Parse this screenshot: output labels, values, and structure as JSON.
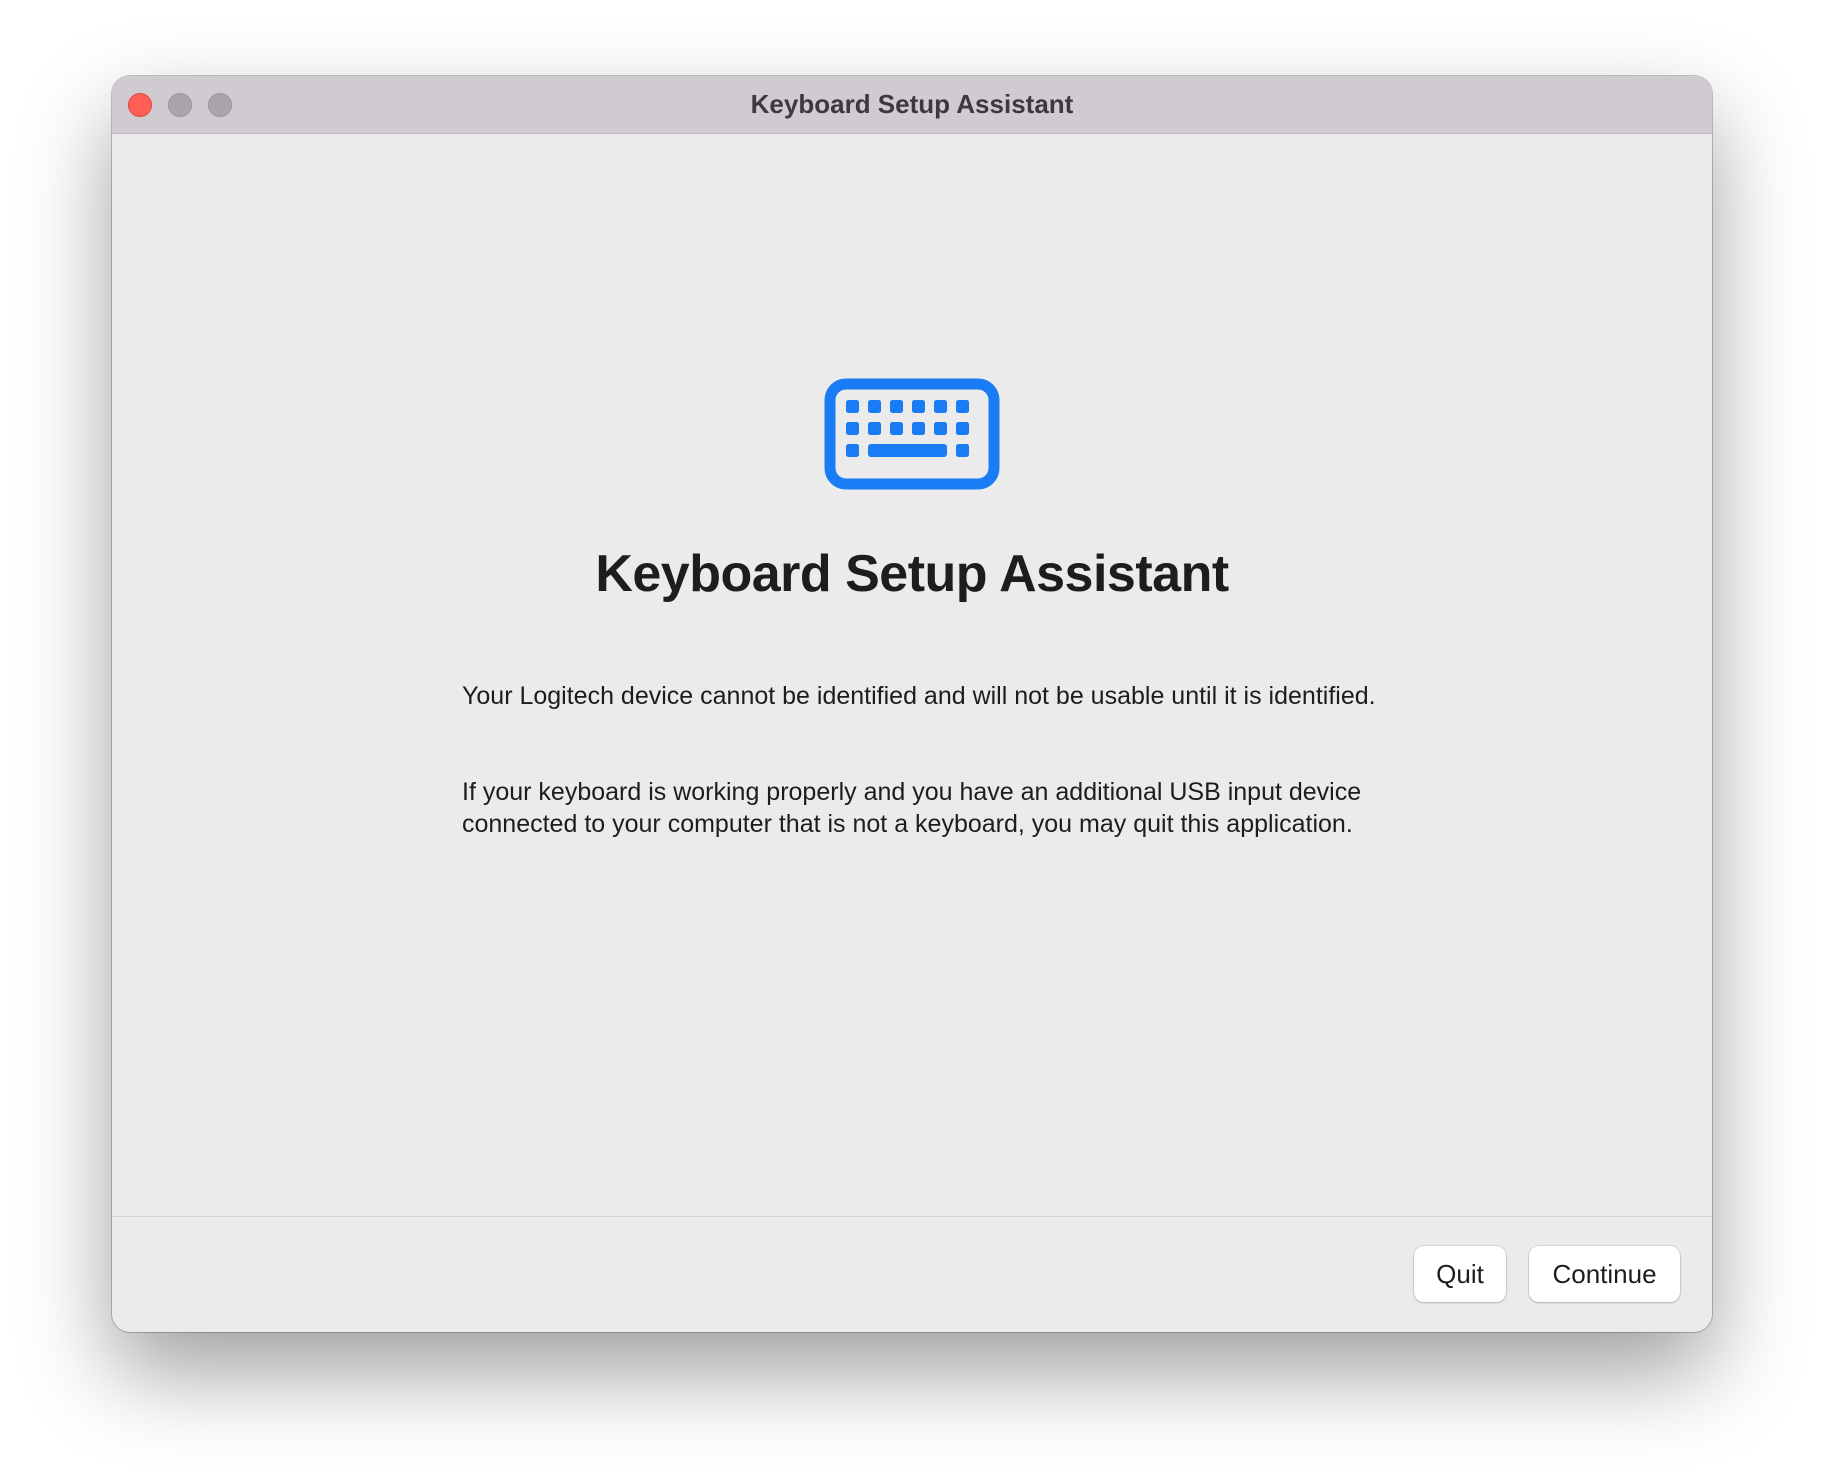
{
  "window": {
    "title": "Keyboard Setup Assistant",
    "traffic_lights": {
      "close_color": "#ff5f57",
      "minimize_color": "#aaa5ab",
      "zoom_color": "#aaa5ab"
    }
  },
  "main": {
    "icon": "keyboard-icon",
    "icon_color": "#1a7cf5",
    "heading": "Keyboard Setup Assistant",
    "paragraphs": [
      "Your Logitech device cannot be identified and will not be usable until it is identified.",
      "If your keyboard is working properly and you have an additional USB input device connected to your computer that is not a keyboard, you may quit this application."
    ]
  },
  "footer": {
    "quit_label": "Quit",
    "continue_label": "Continue"
  }
}
